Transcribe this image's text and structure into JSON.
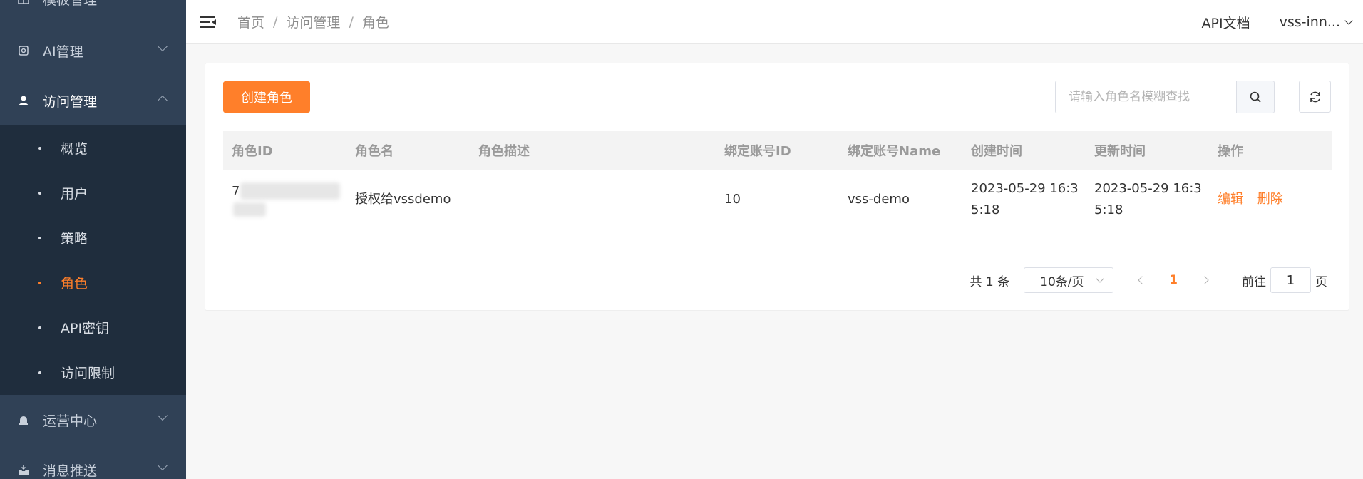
{
  "sidebar": {
    "partial_top": "模板管理",
    "ai_menu": "AI管理",
    "access_menu": "访问管理",
    "sub_items": [
      "概览",
      "用户",
      "策略",
      "角色",
      "API密钥",
      "访问限制"
    ],
    "active_index": 3,
    "ops_menu": "运营中心",
    "push_menu": "消息推送"
  },
  "header": {
    "breadcrumb": [
      "首页",
      "访问管理",
      "角色"
    ],
    "api_docs": "API文档",
    "user": "vss-inn..."
  },
  "toolbar": {
    "create_label": "创建角色",
    "search_placeholder": "请输入角色名模糊查找"
  },
  "table": {
    "columns": [
      "角色ID",
      "角色名",
      "角色描述",
      "绑定账号ID",
      "绑定账号Name",
      "创建时间",
      "更新时间",
      "操作"
    ],
    "rows": [
      {
        "id_visible_char": "7",
        "name": "授权给vssdemo",
        "desc": "",
        "account_id": "10",
        "account_name": "vss-demo",
        "created_1": "2023-05-29 16:3",
        "created_2": "5:18",
        "updated_1": "2023-05-29 16:3",
        "updated_2": "5:18",
        "edit": "编辑",
        "delete": "删除"
      }
    ]
  },
  "pagination": {
    "total": "共 1 条",
    "page_size": "10条/页",
    "current": "1",
    "goto_label": "前往",
    "goto_value": "1",
    "goto_suffix": "页"
  },
  "colors": {
    "accent": "#ff7f2a",
    "sidebar": "#304156",
    "submenu": "#1f2d3d"
  }
}
